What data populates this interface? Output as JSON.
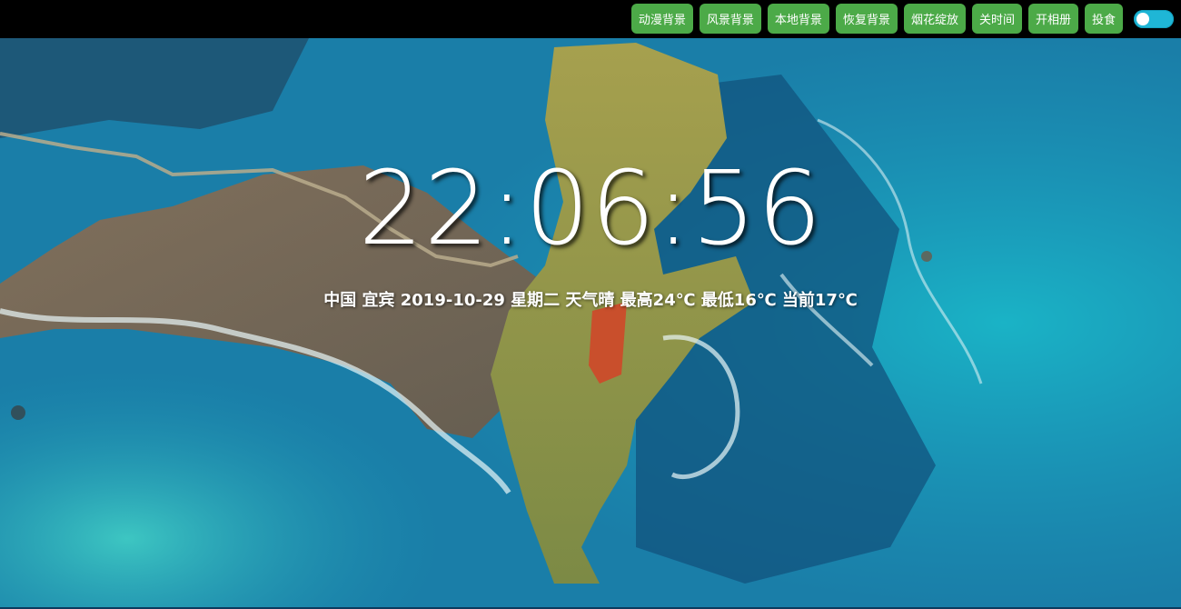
{
  "toolbar": {
    "buttons": [
      {
        "label": "动漫背景"
      },
      {
        "label": "风景背景"
      },
      {
        "label": "本地背景"
      },
      {
        "label": "恢复背景"
      },
      {
        "label": "烟花绽放"
      },
      {
        "label": "关时间"
      },
      {
        "label": "开相册"
      },
      {
        "label": "投食"
      }
    ],
    "toggle_state": "off",
    "button_color": "#4caa48",
    "toggle_color": "#1fb6d6"
  },
  "clock": {
    "time": "22:06:56"
  },
  "info": {
    "line": "中国 宜宾 2019-10-29 星期二 天气晴 最高24℃ 最低16℃ 当前17℃"
  },
  "background": {
    "description_icon": "aerial-coast-background-image"
  }
}
